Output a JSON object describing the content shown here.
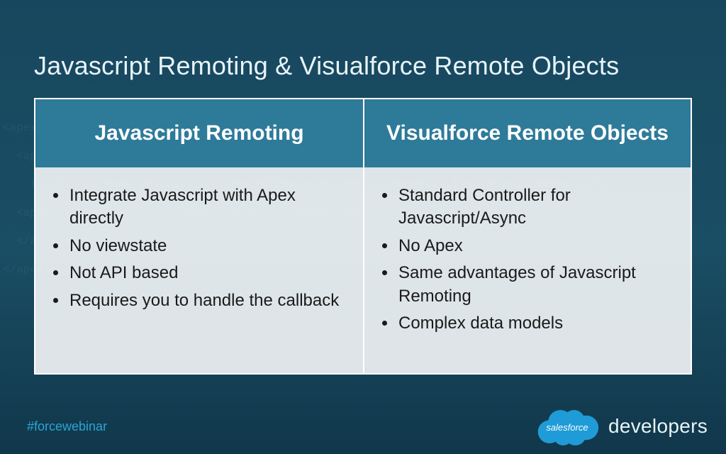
{
  "title": "Javascript Remoting & Visualforce Remote Objects",
  "columns": [
    {
      "header": "Javascript Remoting",
      "bullets": [
        "Integrate Javascript with Apex directly",
        "No viewstate",
        "Not API based",
        "Requires you to handle the callback"
      ]
    },
    {
      "header": "Visualforce Remote Objects",
      "bullets": [
        "Standard Controller for Javascript/Async",
        "No Apex",
        "Same advantages of Javascript Remoting",
        "Complex data models"
      ]
    }
  ],
  "footer": {
    "hashtag": "#forcewebinar",
    "cloud_label": "salesforce",
    "brand_word": "developers"
  },
  "colors": {
    "slide_bg_top": "#17475e",
    "slide_bg_bottom": "#11374b",
    "header_bg": "#2e7a99",
    "body_bg": "rgba(255,255,255,0.86)",
    "accent": "#2aa4d6",
    "cloud": "#1f9bd7"
  }
}
